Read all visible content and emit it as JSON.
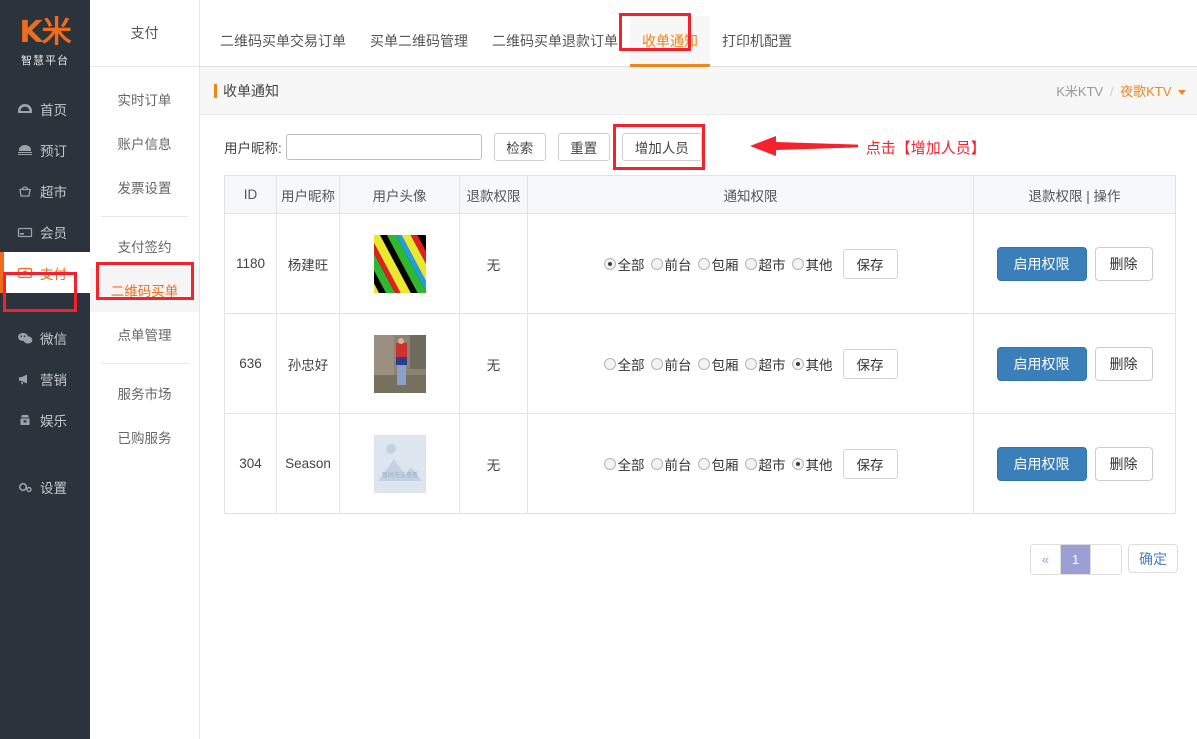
{
  "brand": {
    "mark": "K米",
    "sub": "智慧平台",
    "accent": "#ef6c1a"
  },
  "sidebar": {
    "items": [
      {
        "label": "首页",
        "icon": "dashboard-icon",
        "active": false
      },
      {
        "label": "预订",
        "icon": "booking-icon",
        "active": false
      },
      {
        "label": "超市",
        "icon": "store-icon",
        "active": false
      },
      {
        "label": "会员",
        "icon": "card-icon",
        "active": false
      },
      {
        "label": "支付",
        "icon": "payment-icon",
        "active": true
      },
      {
        "label": "微信",
        "icon": "wechat-icon",
        "active": false
      },
      {
        "label": "营销",
        "icon": "megaphone-icon",
        "active": false
      },
      {
        "label": "娱乐",
        "icon": "entertainment-icon",
        "active": false
      },
      {
        "label": "设置",
        "icon": "gear-icon",
        "active": false
      }
    ]
  },
  "subnav": {
    "title": "支付",
    "groups": [
      [
        {
          "label": "实时订单",
          "active": false
        },
        {
          "label": "账户信息",
          "active": false
        },
        {
          "label": "发票设置",
          "active": false
        }
      ],
      [
        {
          "label": "支付签约",
          "active": false
        },
        {
          "label": "二维码买单",
          "active": true
        },
        {
          "label": "点单管理",
          "active": false
        }
      ],
      [
        {
          "label": "服务市场",
          "active": false
        },
        {
          "label": "已购服务",
          "active": false
        }
      ]
    ]
  },
  "tabs": [
    {
      "label": "二维码买单交易订单",
      "active": false
    },
    {
      "label": "买单二维码管理",
      "active": false
    },
    {
      "label": "二维码买单退款订单",
      "active": false
    },
    {
      "label": "收单通知",
      "active": true
    },
    {
      "label": "打印机配置",
      "active": false
    }
  ],
  "page": {
    "title": "收单通知",
    "breadcrumb": {
      "root": "K米KTV",
      "sep": "/",
      "current": "夜歌KTV"
    }
  },
  "filter": {
    "label": "用户昵称:",
    "value": "",
    "placeholder": "",
    "search_label": "检索",
    "reset_label": "重置",
    "add_label": "增加人员"
  },
  "annotation": {
    "text": "点击【增加人员】",
    "color": "#f5222d"
  },
  "table": {
    "headers": [
      "ID",
      "用户昵称",
      "用户头像",
      "退款权限",
      "通知权限",
      "退款权限 | 操作"
    ],
    "radio_options": [
      "全部",
      "前台",
      "包厢",
      "超市",
      "其他"
    ],
    "save_label": "保存",
    "enable_label": "启用权限",
    "delete_label": "删除",
    "avatar_placeholder_text": "暂时无法查看",
    "rows": [
      {
        "id": "1180",
        "nick": "杨建旺",
        "avatar": "stripes",
        "refund": "无",
        "selected": "全部"
      },
      {
        "id": "636",
        "nick": "孙忠好",
        "avatar": "photo",
        "refund": "无",
        "selected": "其他"
      },
      {
        "id": "304",
        "nick": "Season",
        "avatar": "missing",
        "refund": "无",
        "selected": "其他"
      }
    ]
  },
  "pager": {
    "prev_label": "«",
    "pages": [
      "1"
    ],
    "current": "1",
    "confirm_label": "确定"
  }
}
